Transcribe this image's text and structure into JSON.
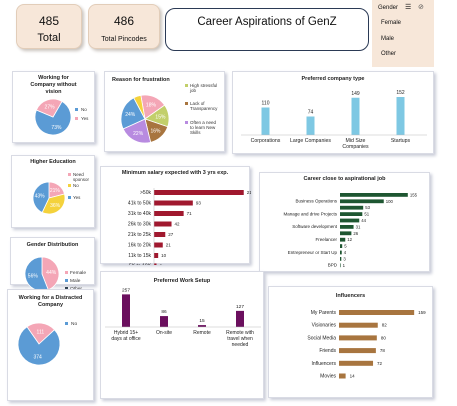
{
  "kpis": {
    "total": {
      "value": "485",
      "label": "Total"
    },
    "pincodes": {
      "value": "486",
      "label": "Total Pincodes"
    }
  },
  "dashboard_title": "Career Aspirations of GenZ",
  "slicer": {
    "title": "Gender",
    "items": [
      "Female",
      "Male",
      "Other"
    ]
  },
  "colors": {
    "blue": "#5b9bd5",
    "pink": "#f4a6b6",
    "cyan": "#7ec8e3",
    "bar_red": "#a0182e",
    "purple": "#6b0f5e",
    "brown": "#a8753f",
    "olive": "#c2cf6a",
    "yellow": "#f4d23c",
    "orange": "#f0b470",
    "teal": "#2f8f8f",
    "lav": "#b88be0",
    "darkgreen": "#1e5631",
    "slate": "#2c3e4c"
  },
  "chart_data": [
    {
      "id": "vision",
      "type": "pie",
      "title": "Working for Company without vision",
      "labels": [
        "No",
        "Yes"
      ],
      "values": [
        73,
        27
      ],
      "value_labels": [
        "73%",
        "27%"
      ]
    },
    {
      "id": "frustration",
      "type": "pie",
      "title": "Reason for frustration",
      "labels": [
        "High stressful job",
        "Lack of Transparency",
        "Often a need to learn New Skills"
      ],
      "values": [
        18,
        15,
        16,
        22,
        24,
        5
      ],
      "value_labels": [
        "18%",
        "15%",
        "16%",
        "22%",
        "24%",
        ""
      ]
    },
    {
      "id": "company_type",
      "type": "bar",
      "title": "Preferred company type",
      "categories": [
        "Corporations",
        "Large Companies",
        "Mid Size Companies",
        "Startups"
      ],
      "values": [
        110,
        74,
        149,
        152
      ]
    },
    {
      "id": "education",
      "type": "pie",
      "title": "Higher Education",
      "labels": [
        "Need sponsor",
        "No",
        "Yes"
      ],
      "values": [
        21,
        36,
        43
      ],
      "value_labels": [
        "21%",
        "36%",
        "43%"
      ]
    },
    {
      "id": "salary",
      "type": "bar",
      "title": "Minimum salary expected with 3 yrs exp.",
      "categories": [
        ">50k",
        "41k to 50k",
        "31k to 40k",
        "26k to 30k",
        "21k to 25k",
        "16k to 20k",
        "11k to 15k",
        "5K to 10K"
      ],
      "values": [
        215,
        93,
        71,
        42,
        27,
        21,
        10,
        6
      ]
    },
    {
      "id": "career_job",
      "type": "bar",
      "title": "Career close to aspirational job",
      "categories": [
        "",
        "Business Operations",
        "",
        "Manage and drive Projects",
        "",
        "Software development",
        "",
        "Freelancer",
        "",
        "Entrepreneur or Start Up",
        "",
        "BPD"
      ],
      "values": [
        155,
        100,
        53,
        51,
        44,
        31,
        26,
        12,
        5,
        4,
        3,
        1
      ]
    },
    {
      "id": "gender",
      "type": "pie",
      "title": "Gender Distribution",
      "labels": [
        "Female",
        "Male",
        "Other"
      ],
      "values": [
        44,
        56,
        0
      ],
      "value_labels": [
        "44%",
        "56%",
        "0%"
      ]
    },
    {
      "id": "distracted",
      "type": "pie",
      "title": "Working for a Distracted Company",
      "labels": [
        "No"
      ],
      "values": [
        111,
        374
      ],
      "value_labels": [
        "111",
        "374"
      ]
    },
    {
      "id": "work_setup",
      "type": "bar",
      "title": "Preferred Work Setup",
      "categories": [
        "Hybrid 15+ days at office",
        "On-site",
        "Remote",
        "Remote with travel when needed"
      ],
      "values": [
        257,
        86,
        15,
        127
      ]
    },
    {
      "id": "influencers",
      "type": "bar",
      "title": "Influencers",
      "categories": [
        "My Parents",
        "Visionaries",
        "Social Media",
        "Friends",
        "Influencers",
        "Movies"
      ],
      "values": [
        159,
        82,
        80,
        78,
        72,
        14
      ]
    }
  ]
}
